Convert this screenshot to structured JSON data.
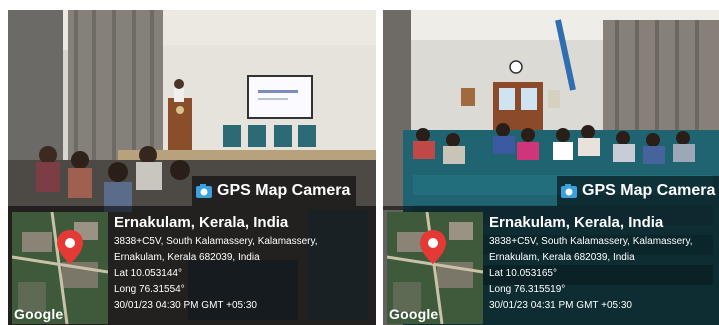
{
  "photos": [
    {
      "camera_label": "GPS Map Camera",
      "location_title": "Ernakulam, Kerala, India",
      "address_line1": "3838+C5V, South Kalamassery, Kalamassery,",
      "address_line2": "Ernakulam, Kerala 682039, India",
      "latitude": "Lat 10.053144°",
      "longitude": "Long 76.31554°",
      "timestamp": "30/01/23 04:30 PM GMT +05:30",
      "map_brand": "Google"
    },
    {
      "camera_label": "GPS Map Camera",
      "location_title": "Ernakulam, Kerala, India",
      "address_line1": "3838+C5V, South Kalamassery, Kalamassery,",
      "address_line2": "Ernakulam, Kerala 682039, India",
      "latitude": "Lat 10.053165°",
      "longitude": "Long 76.315519°",
      "timestamp": "30/01/23 04:31 PM GMT +05:30",
      "map_brand": "Google"
    }
  ],
  "colors": {
    "overlay": "#000000",
    "map_pin": "#e53935",
    "chairs": "#1f6f7a"
  },
  "icons": [
    "camera-icon",
    "map-pin-icon"
  ]
}
